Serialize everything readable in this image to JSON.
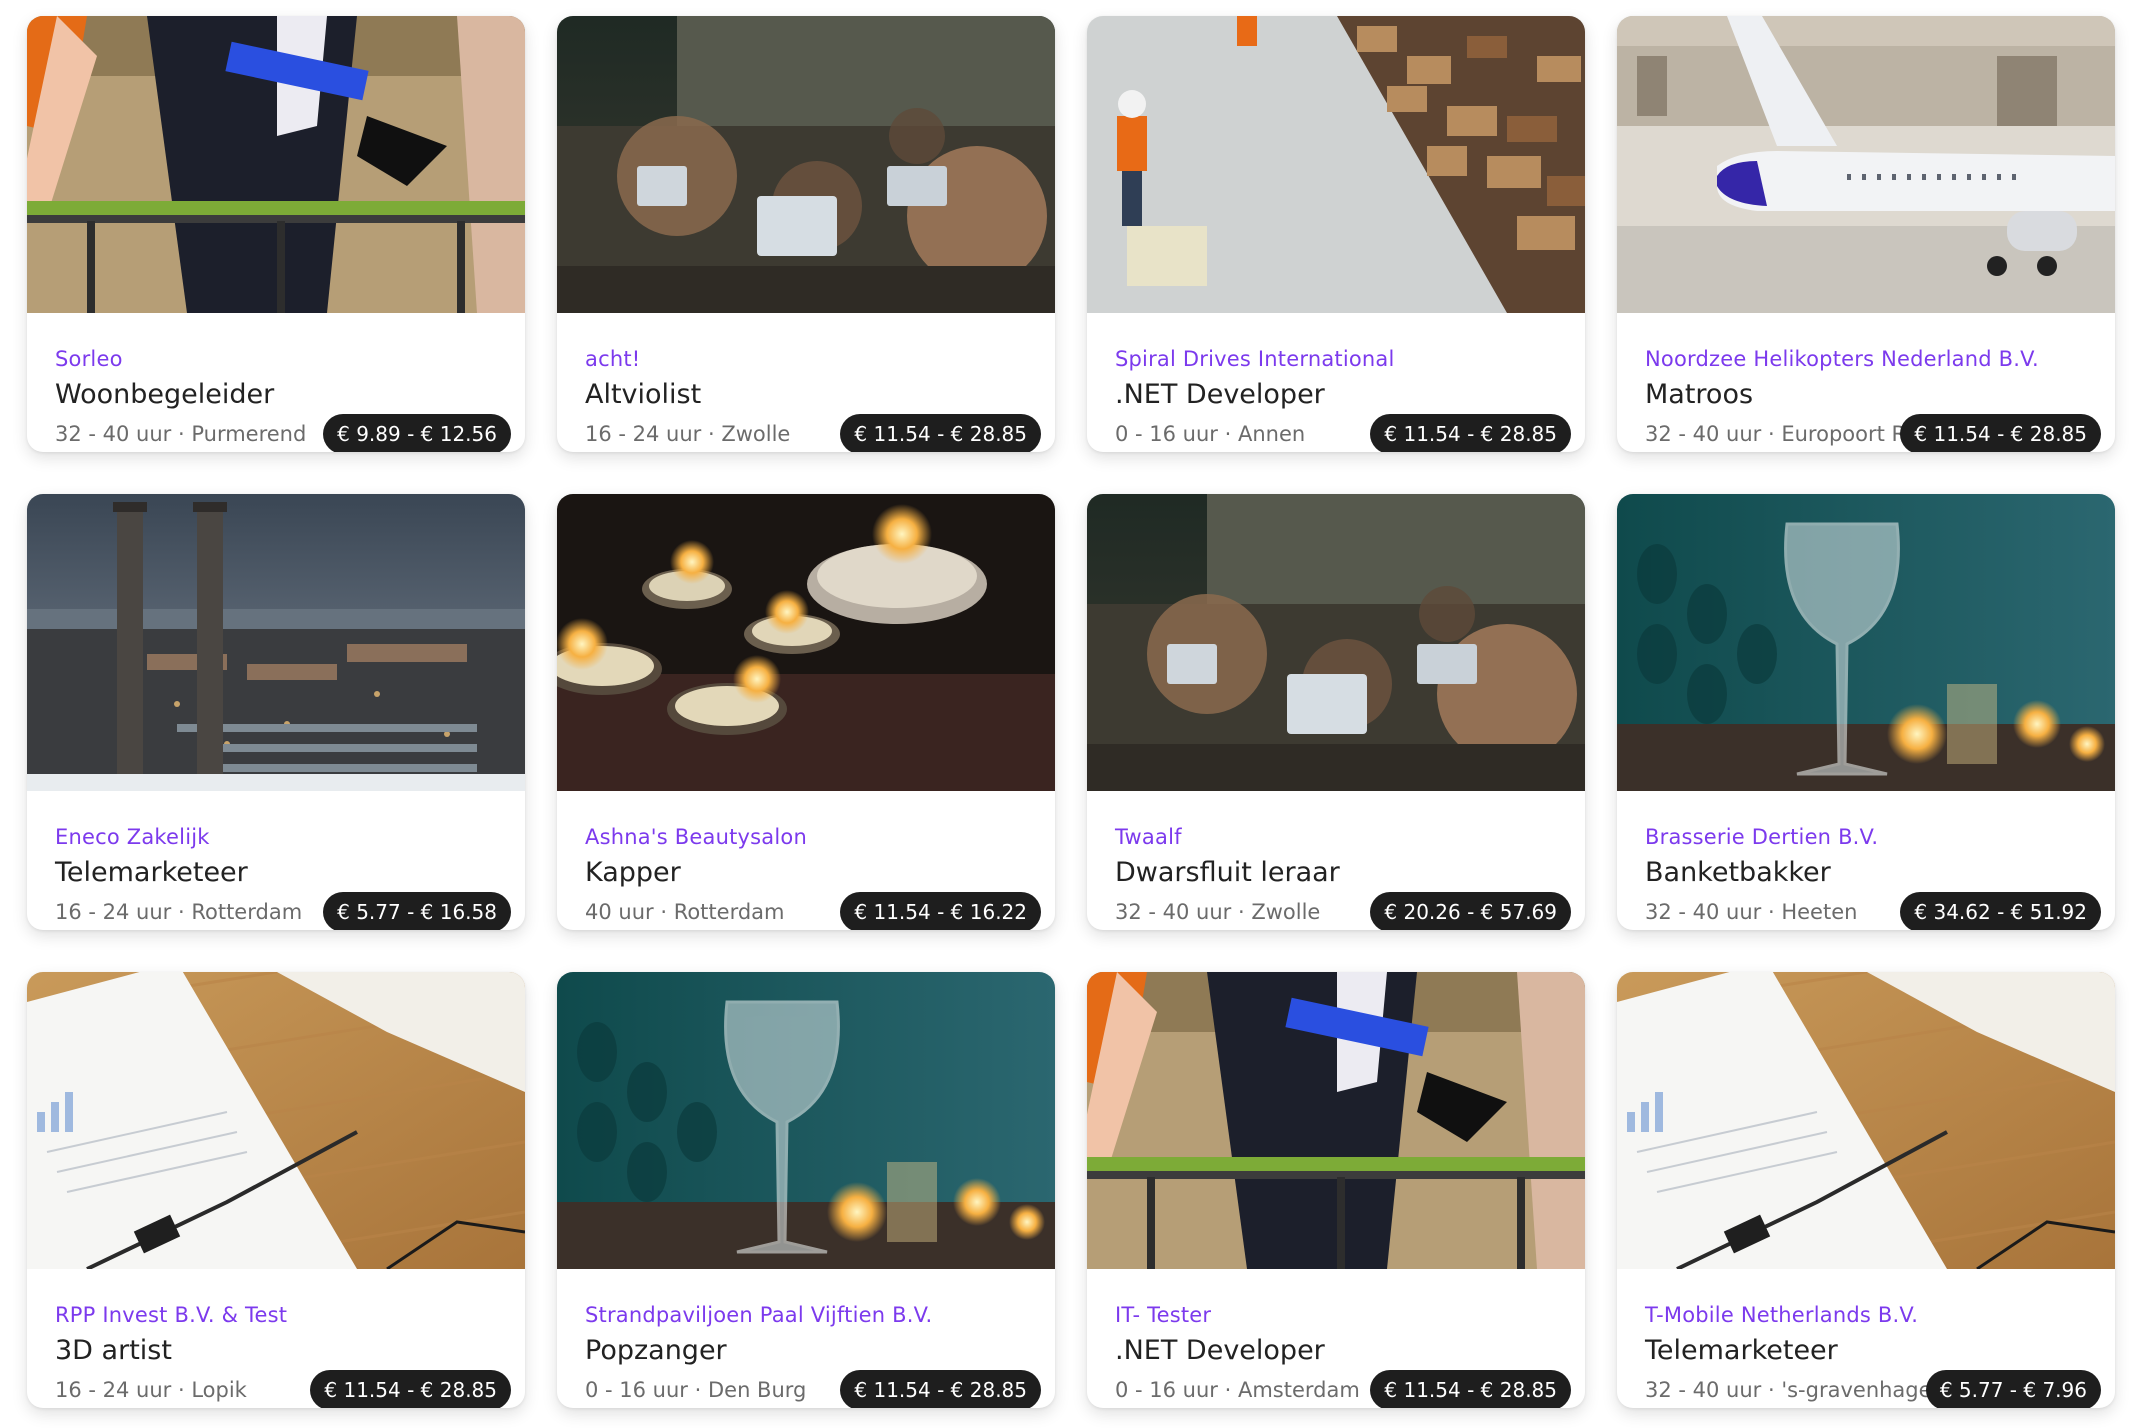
{
  "jobs": [
    {
      "company": "Sorleo",
      "title": "Woonbegeleider",
      "hours": "32 - 40 uur",
      "location": "Purmerend",
      "wage": "€ 9.89 - € 12.56",
      "image": "interview-chairs"
    },
    {
      "company": "acht!",
      "title": "Altviolist",
      "hours": "16 - 24 uur",
      "location": "Zwolle",
      "wage": "€ 11.54 - € 28.85",
      "image": "lecture-hall"
    },
    {
      "company": "Spiral Drives International",
      "title": ".NET Developer",
      "hours": "0 - 16 uur",
      "location": "Annen",
      "wage": "€ 11.54 - € 28.85",
      "image": "warehouse"
    },
    {
      "company": "Noordzee Helikopters Nederland B.V.",
      "title": "Matroos",
      "hours": "32 - 40 uur",
      "location": "Europoort Rotterdam",
      "wage": "€ 11.54 - € 28.85",
      "image": "airplane"
    },
    {
      "company": "Eneco Zakelijk",
      "title": "Telemarketeer",
      "hours": "16 - 24 uur",
      "location": "Rotterdam",
      "wage": "€ 5.77 - € 16.58",
      "image": "harbor-chimneys"
    },
    {
      "company": "Ashna's Beautysalon",
      "title": "Kapper",
      "hours": "40 uur",
      "location": "Rotterdam",
      "wage": "€ 11.54 - € 16.22",
      "image": "candles"
    },
    {
      "company": "Twaalf",
      "title": "Dwarsfluit leraar",
      "hours": "32 - 40 uur",
      "location": "Zwolle",
      "wage": "€ 20.26 - € 57.69",
      "image": "lecture-hall"
    },
    {
      "company": "Brasserie Dertien B.V.",
      "title": "Banketbakker",
      "hours": "32 - 40 uur",
      "location": "Heeten",
      "wage": "€ 34.62 - € 51.92",
      "image": "wine-glass"
    },
    {
      "company": "RPP Invest B.V. & Test",
      "title": "3D artist",
      "hours": "16 - 24 uur",
      "location": "Lopik",
      "wage": "€ 11.54 - € 28.85",
      "image": "clipboard-desk"
    },
    {
      "company": "Strandpaviljoen Paal Vijftien B.V.",
      "title": "Popzanger",
      "hours": "0 - 16 uur",
      "location": "Den Burg",
      "wage": "€ 11.54 - € 28.85",
      "image": "wine-glass"
    },
    {
      "company": "IT- Tester",
      "title": ".NET Developer",
      "hours": "0 - 16 uur",
      "location": "Amsterdam",
      "wage": "€ 11.54 - € 28.85",
      "image": "interview-chairs"
    },
    {
      "company": "T-Mobile Netherlands B.V.",
      "title": "Telemarketeer",
      "hours": "32 - 40 uur",
      "location": "'s-gravenhage",
      "wage": "€ 5.77 - € 7.96",
      "image": "clipboard-desk"
    }
  ]
}
